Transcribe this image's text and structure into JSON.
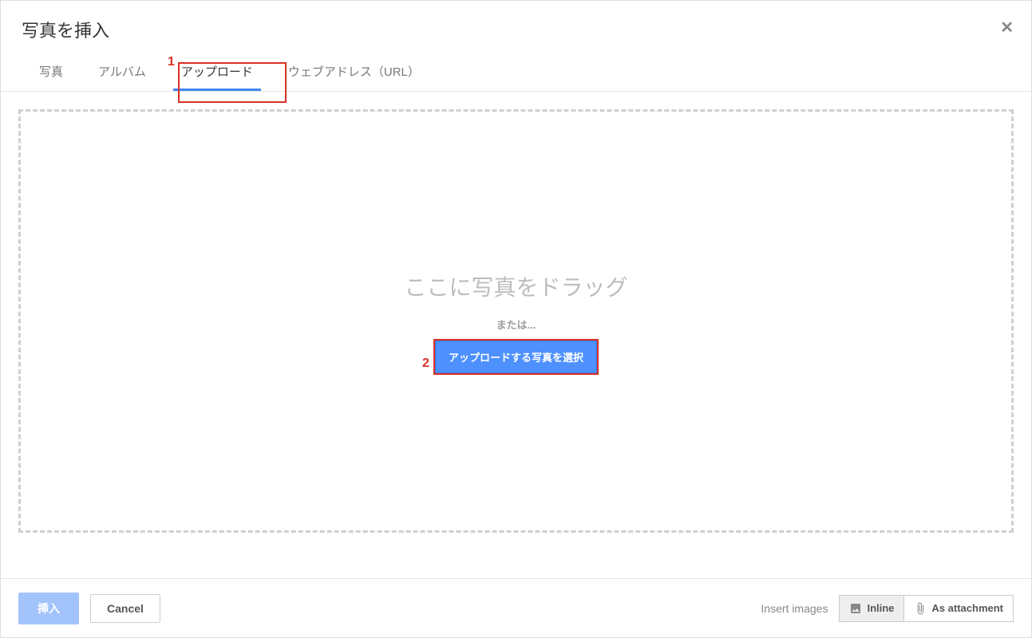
{
  "dialog": {
    "title": "写真を挿入"
  },
  "tabs": {
    "photos": "写真",
    "albums": "アルバム",
    "upload": "アップロード",
    "url": "ウェブアドレス（URL）"
  },
  "dropzone": {
    "drag_text": "ここに写真をドラッグ",
    "or_text": "または...",
    "select_button": "アップロードする写真を選択"
  },
  "footer": {
    "insert": "挿入",
    "cancel": "Cancel",
    "insert_images_label": "Insert images",
    "inline": "Inline",
    "attachment": "As attachment"
  },
  "annotations": {
    "one": "1",
    "two": "2"
  }
}
